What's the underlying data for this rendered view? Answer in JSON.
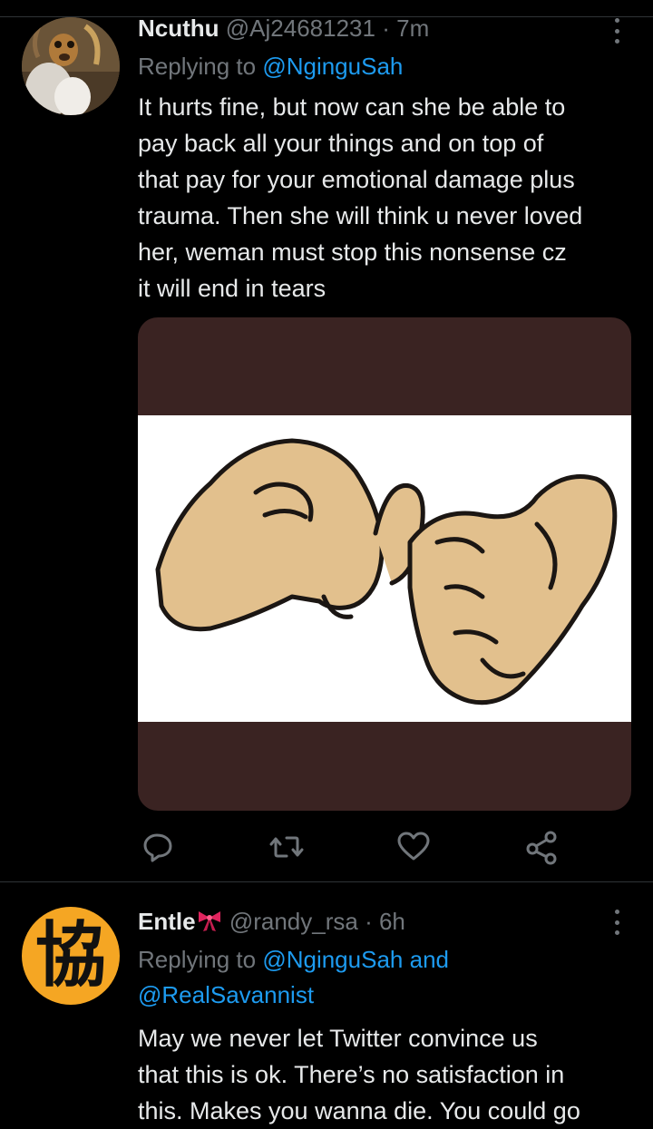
{
  "colors": {
    "background": "#000000",
    "text": "#e7e9ea",
    "muted": "#71767b",
    "accent": "#1d9bf0",
    "divider": "#2f3336",
    "media_frame": "#3a2322",
    "skin": "#e2c08d"
  },
  "tweets": [
    {
      "name": "Ncuthu",
      "handle": "@Aj24681231",
      "separator": "·",
      "time": "7m",
      "replying_prefix": "Replying to",
      "replying_mentions": [
        "@NginguSah"
      ],
      "text_lines": [
        "It hurts fine, but now can she be able to",
        "pay back all your things and on top of",
        "that pay for your emotional damage plus",
        "trauma. Then she will think u never loved",
        "her, weman must stop this nonsense cz",
        "it will end in tears"
      ],
      "media_icon": "pinky-promise-hands-image",
      "actions": [
        "reply-icon",
        "retweet-icon",
        "like-icon",
        "share-icon"
      ]
    },
    {
      "name": "Entle",
      "name_emoji_icon": "ribbon-bow-icon",
      "handle": "@randy_rsa",
      "separator": "·",
      "time": "6h",
      "replying_prefix": "Replying to",
      "replying_mentions": [
        "@NginguSah",
        "@RealSavannist"
      ],
      "replying_joiner": "and",
      "avatar_glyph": "協",
      "text_lines": [
        "May we never let Twitter convince us",
        "that this is ok. There’s no satisfaction in",
        "this. Makes you wanna die. You could go"
      ]
    }
  ]
}
